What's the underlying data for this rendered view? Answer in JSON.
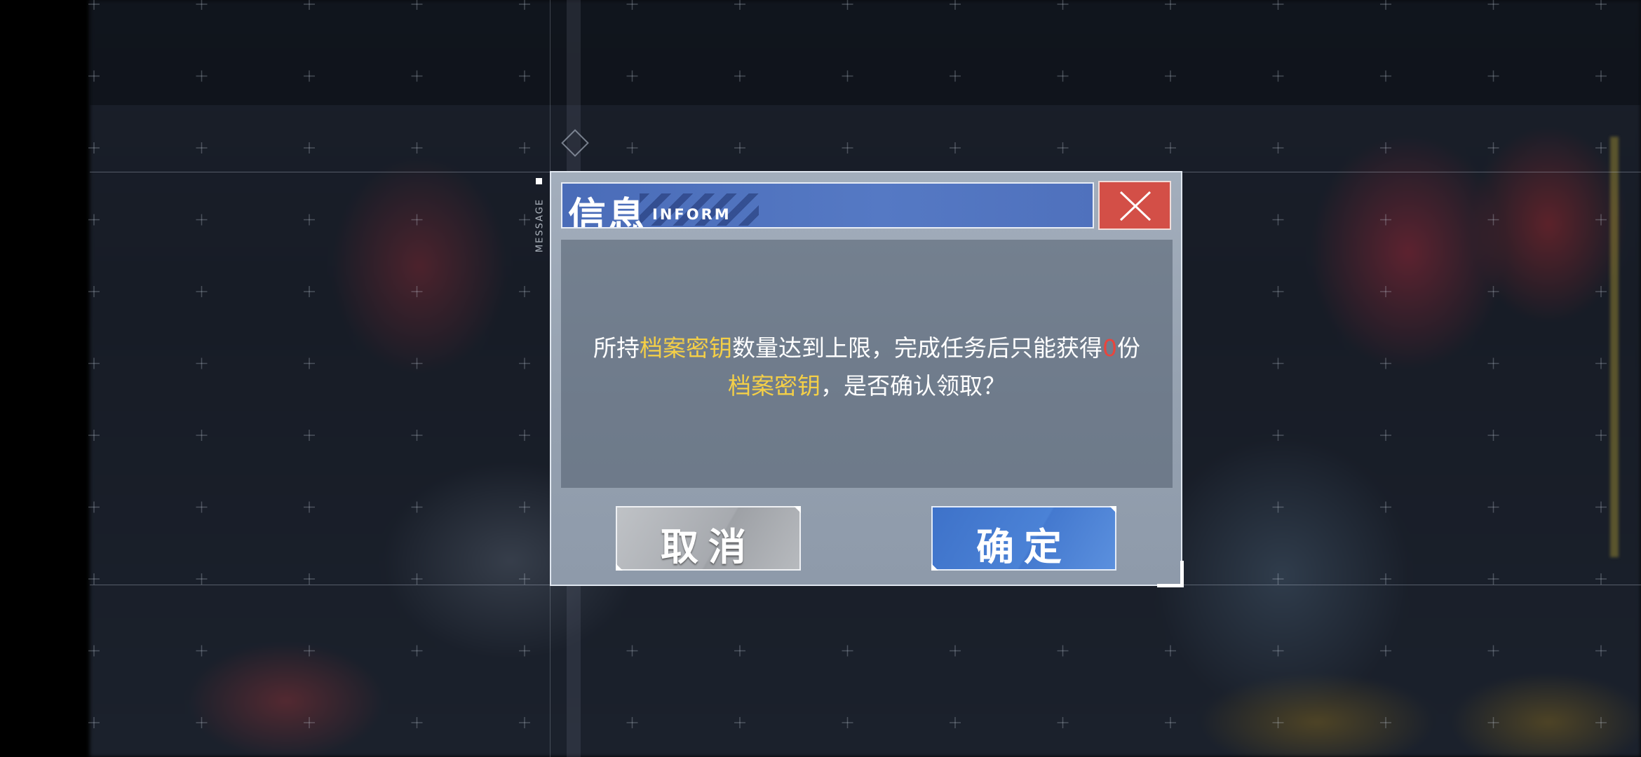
{
  "dialog": {
    "side_tag": "MESSAGE",
    "title": "信息",
    "title_sub": "INFORM",
    "close_icon": "close-icon",
    "message": {
      "p1": "所持",
      "p2": "档案密钥",
      "p3": "数量达到上限，完成任务后只能获得",
      "p4": "0",
      "p5": "份",
      "p6": "档案密钥",
      "p7": "，是否确认领取？"
    },
    "cancel_label": "取消",
    "confirm_label": "确定"
  },
  "colors": {
    "title_blue": "#4a6cb8",
    "close_red": "#d34f47",
    "highlight_yellow": "#f4cf47",
    "count_red": "#e8453d",
    "confirm_blue": "#4479cf",
    "cancel_gray": "#a7aaaf"
  }
}
